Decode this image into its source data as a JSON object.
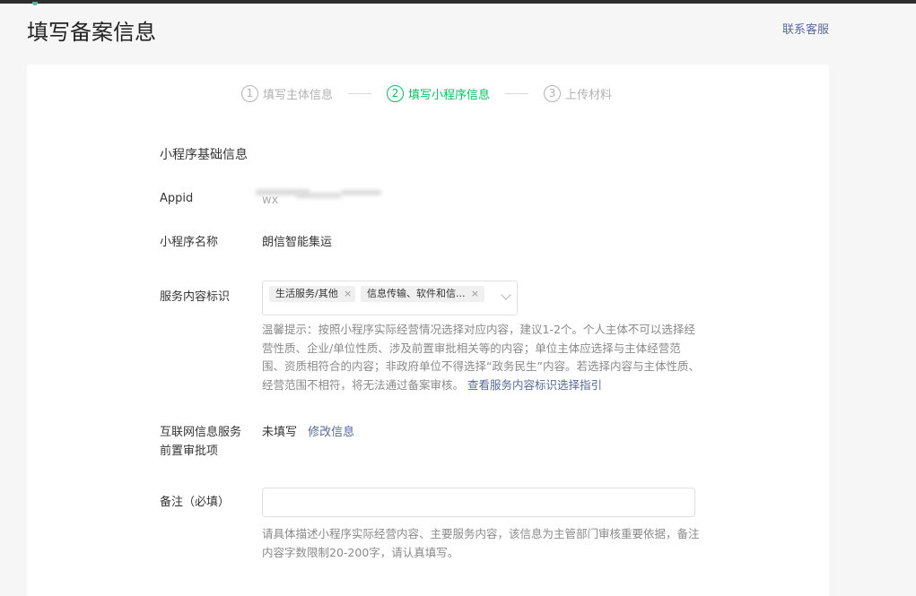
{
  "page": {
    "title": "填写备案信息",
    "contact_label": "联系客服"
  },
  "steps": [
    {
      "num": "1",
      "label": "填写主体信息"
    },
    {
      "num": "2",
      "label": "填写小程序信息"
    },
    {
      "num": "3",
      "label": "上传材料"
    }
  ],
  "form": {
    "section_title": "小程序基础信息",
    "appid_label": "Appid",
    "appid_value": "wx",
    "name_label": "小程序名称",
    "name_value": "朗信智能集运",
    "service_label": "服务内容标识",
    "tags": [
      "生活服务/其他",
      "信息传输、软件和信..."
    ],
    "tag_remove_glyph": "×",
    "hint_text": "温馨提示：按照小程序实际经营情况选择对应内容，建议1-2个。个人主体不可以选择经营性质、企业/单位性质、涉及前置审批相关等的内容；单位主体应选择与主体经营范围、资质相符合的内容；非政府单位不得选择“政务民生”内容。若选择内容与主体性质、经营范围不相符，将无法通过备案审核。",
    "hint_link": "查看服务内容标识选择指引",
    "preapproval_label_line1": "互联网信息服务",
    "preapproval_label_line2": "前置审批项",
    "preapproval_value": "未填写",
    "preapproval_edit": "修改信息",
    "remark_label": "备注（必填）",
    "remark_value": "",
    "remark_placeholder": "",
    "remark_hint": "请具体描述小程序实际经营内容、主要服务内容，该信息为主管部门审核重要依据，备注内容字数限制20-200字，请认真填写。"
  },
  "colors": {
    "accent_green": "#07c160",
    "link_blue": "#576b95",
    "hint_gray": "#8a8a8a"
  }
}
